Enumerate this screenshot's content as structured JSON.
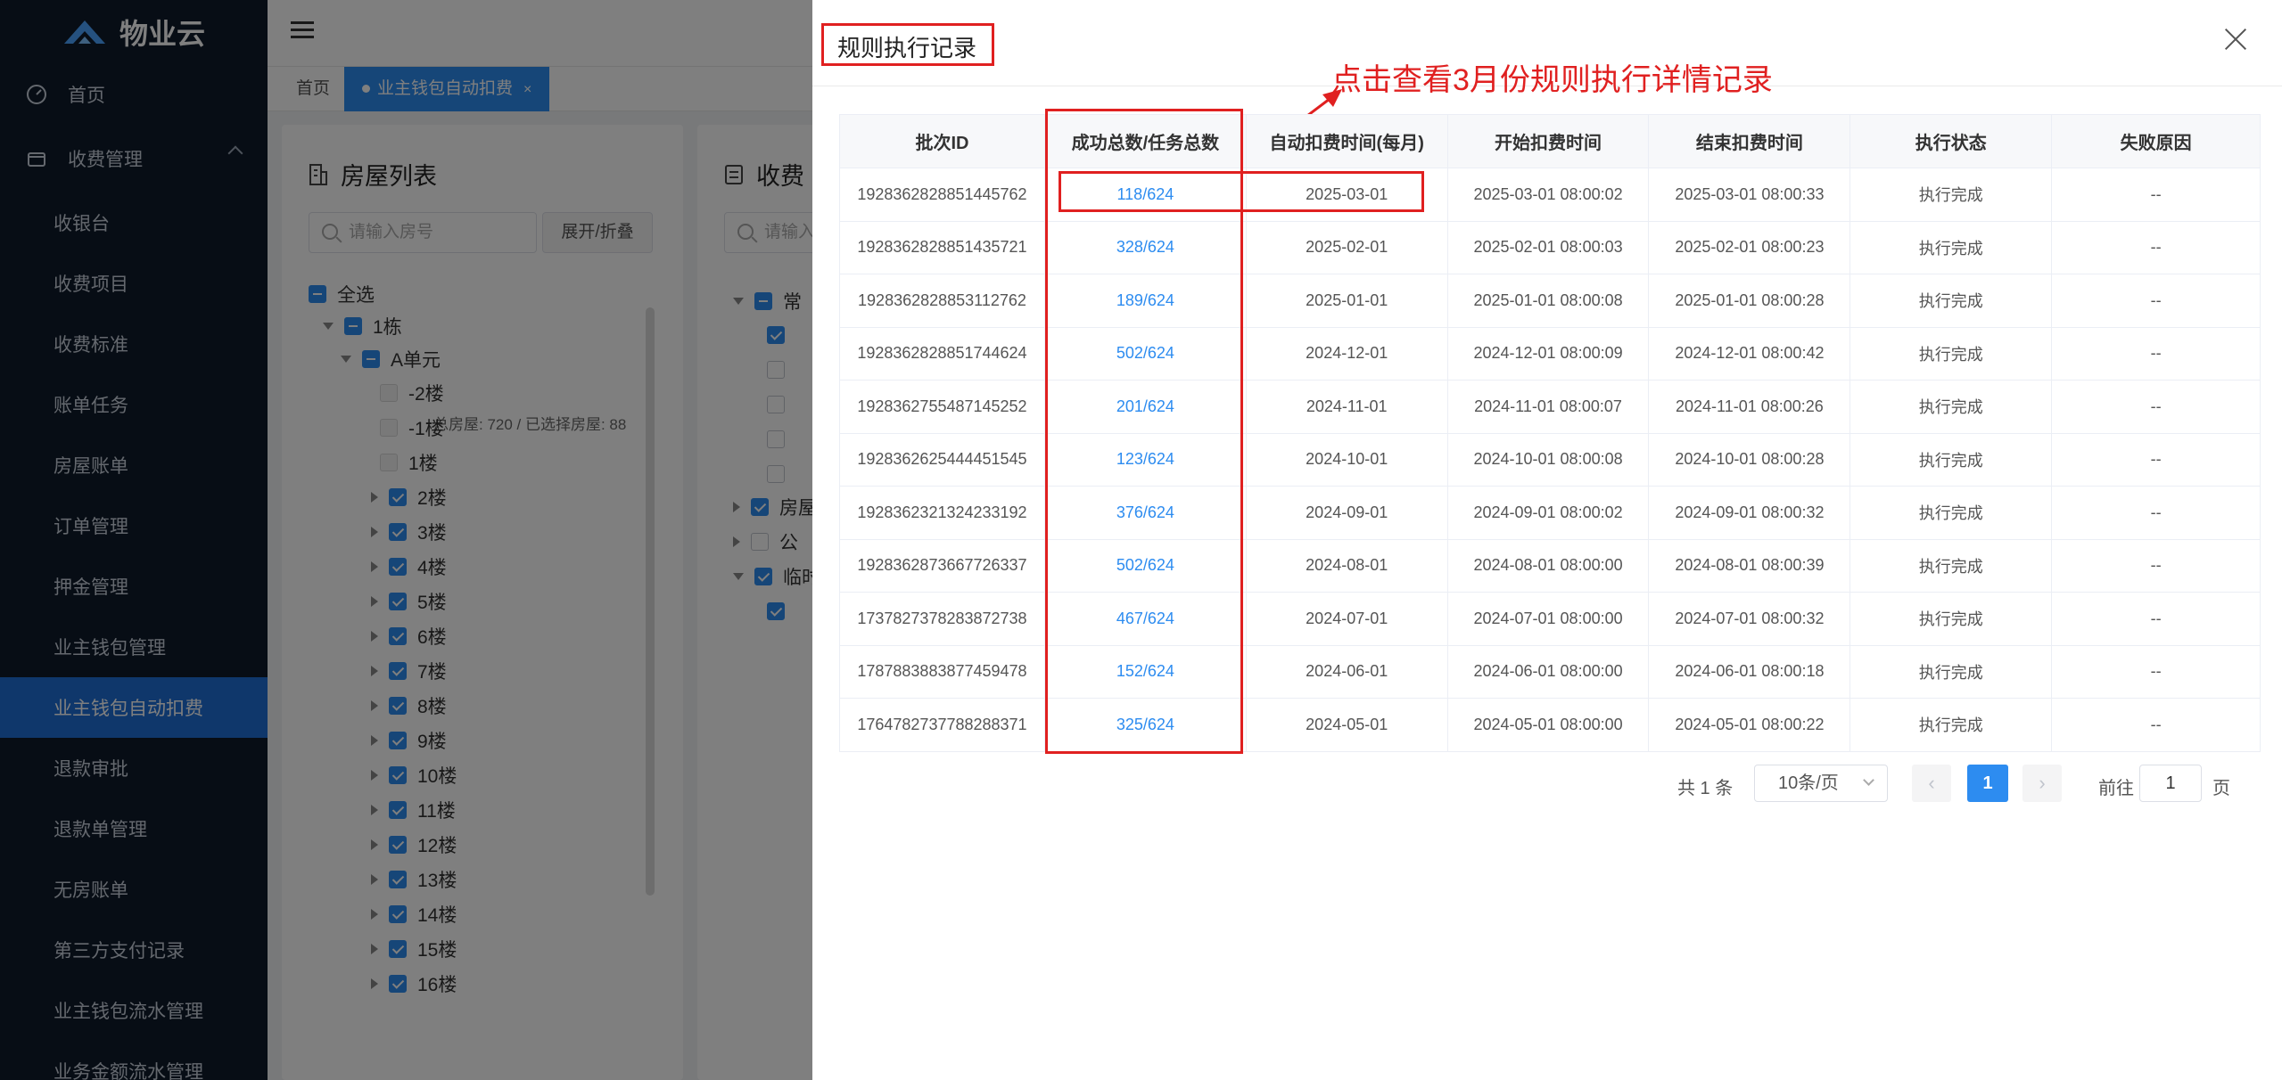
{
  "app": {
    "name": "物业云"
  },
  "sidebar": {
    "items": [
      {
        "label": "首页",
        "icon": "dashboard-icon"
      },
      {
        "label": "收费管理",
        "icon": "wallet-icon"
      },
      {
        "label": "收银台"
      },
      {
        "label": "收费项目"
      },
      {
        "label": "收费标准"
      },
      {
        "label": "账单任务"
      },
      {
        "label": "房屋账单"
      },
      {
        "label": "订单管理"
      },
      {
        "label": "押金管理"
      },
      {
        "label": "业主钱包管理"
      },
      {
        "label": "业主钱包自动扣费",
        "active": true
      },
      {
        "label": "退款审批"
      },
      {
        "label": "退款单管理"
      },
      {
        "label": "无房账单"
      },
      {
        "label": "第三方支付记录"
      },
      {
        "label": "业主钱包流水管理"
      },
      {
        "label": "业务金额流水管理"
      }
    ]
  },
  "tabs": {
    "home": "首页",
    "active": "业主钱包自动扣费",
    "close": "×"
  },
  "house_panel": {
    "title": "房屋列表",
    "search_placeholder": "请输入房号",
    "expand_button": "展开/折叠",
    "select_all": "全选",
    "summary": "总房屋: 720 / 已选择房屋: 88",
    "building": "1栋",
    "unit": "A单元",
    "floors_disabled": [
      "-2楼",
      "-1楼",
      "1楼"
    ],
    "floors": [
      "2楼",
      "3楼",
      "4楼",
      "5楼",
      "6楼",
      "7楼",
      "8楼",
      "9楼",
      "10楼",
      "11楼",
      "12楼",
      "13楼",
      "14楼",
      "15楼",
      "16楼"
    ]
  },
  "fee_panel": {
    "title": "收费",
    "search_placeholder": "请输入",
    "groups": [
      "常",
      "房屋",
      "公",
      "临时"
    ]
  },
  "drawer": {
    "title": "规则执行记录",
    "annotation": "点击查看3月份规则执行详情记录",
    "columns": [
      "批次ID",
      "成功总数/任务总数",
      "自动扣费时间(每月)",
      "开始扣费时间",
      "结束扣费时间",
      "执行状态",
      "失败原因"
    ],
    "rows": [
      [
        "1928362828851445762",
        "118/624",
        "2025-03-01",
        "2025-03-01 08:00:02",
        "2025-03-01 08:00:33",
        "执行完成",
        "--"
      ],
      [
        "1928362828851435721",
        "328/624",
        "2025-02-01",
        "2025-02-01 08:00:03",
        "2025-02-01 08:00:23",
        "执行完成",
        "--"
      ],
      [
        "1928362828853112762",
        "189/624",
        "2025-01-01",
        "2025-01-01 08:00:08",
        "2025-01-01 08:00:28",
        "执行完成",
        "--"
      ],
      [
        "1928362828851744624",
        "502/624",
        "2024-12-01",
        "2024-12-01 08:00:09",
        "2024-12-01 08:00:42",
        "执行完成",
        "--"
      ],
      [
        "1928362755487145252",
        "201/624",
        "2024-11-01",
        "2024-11-01 08:00:07",
        "2024-11-01 08:00:26",
        "执行完成",
        "--"
      ],
      [
        "1928362625444451545",
        "123/624",
        "2024-10-01",
        "2024-10-01 08:00:08",
        "2024-10-01 08:00:28",
        "执行完成",
        "--"
      ],
      [
        "1928362321324233192",
        "376/624",
        "2024-09-01",
        "2024-09-01 08:00:02",
        "2024-09-01 08:00:32",
        "执行完成",
        "--"
      ],
      [
        "1928362873667726337",
        "502/624",
        "2024-08-01",
        "2024-08-01 08:00:00",
        "2024-08-01 08:00:39",
        "执行完成",
        "--"
      ],
      [
        "1737827378283872738",
        "467/624",
        "2024-07-01",
        "2024-07-01 08:00:00",
        "2024-07-01 08:00:32",
        "执行完成",
        "--"
      ],
      [
        "1787883883877459478",
        "152/624",
        "2024-06-01",
        "2024-06-01 08:00:00",
        "2024-06-01 08:00:18",
        "执行完成",
        "--"
      ],
      [
        "1764782737788288371",
        "325/624",
        "2024-05-01",
        "2024-05-01 08:00:00",
        "2024-05-01 08:00:22",
        "执行完成",
        "--"
      ]
    ],
    "pagination": {
      "total": "共 1 条",
      "page_size": "10条/页",
      "current": "1",
      "goto_label": "前往",
      "goto_value": "1",
      "page_suffix": "页"
    }
  },
  "colors": {
    "accent": "#2d8cf0",
    "annotation": "#e02020",
    "sidebar_bg": "#0f1a2a"
  }
}
